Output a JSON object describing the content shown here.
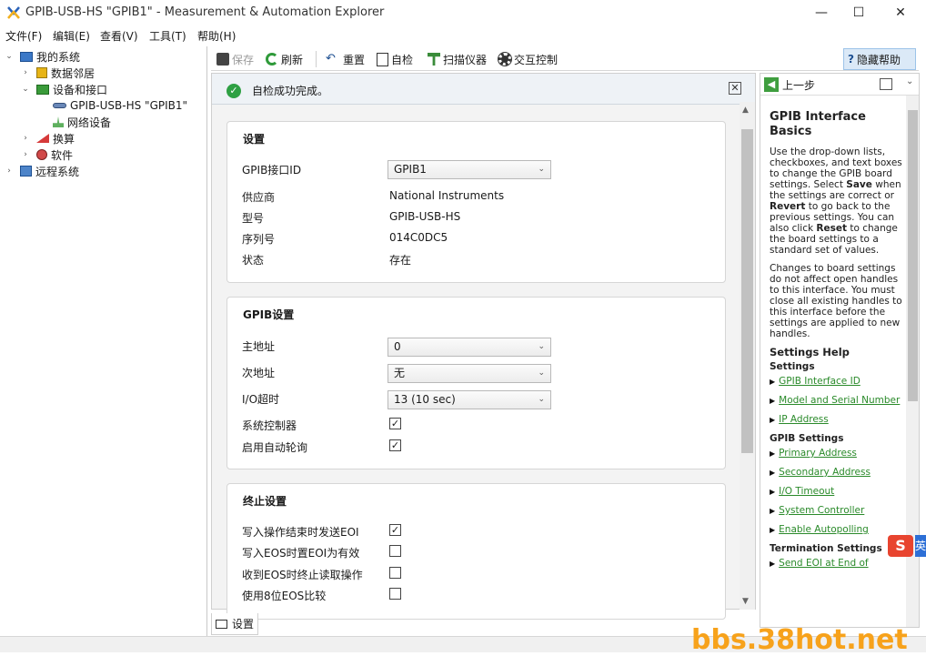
{
  "window": {
    "title": "GPIB-USB-HS \"GPIB1\" - Measurement & Automation Explorer",
    "minimize": "—",
    "maximize": "☐",
    "close": "✕"
  },
  "menu": [
    "文件(F)",
    "编辑(E)",
    "查看(V)",
    "工具(T)",
    "帮助(H)"
  ],
  "tree": [
    {
      "label": "我的系统",
      "expanded": true
    },
    {
      "label": "数据邻居",
      "expanded": false
    },
    {
      "label": "设备和接口",
      "expanded": true
    },
    {
      "label": "GPIB-USB-HS \"GPIB1\""
    },
    {
      "label": "网络设备"
    },
    {
      "label": "换算",
      "expanded": false
    },
    {
      "label": "软件",
      "expanded": false
    },
    {
      "label": "远程系统",
      "expanded": false
    }
  ],
  "toolbar": {
    "save": "保存",
    "refresh": "刷新",
    "reset": "重置",
    "selftest": "自检",
    "scan": "扫描仪器",
    "interactive": "交互控制",
    "hide_help": "隐藏帮助"
  },
  "status": {
    "message": "自检成功完成。",
    "close": "✕"
  },
  "settings_card": {
    "title": "设置",
    "rows": [
      {
        "label": "GPIB接口ID",
        "value": "GPIB1",
        "type": "select"
      },
      {
        "label": "供应商",
        "value": "National Instruments"
      },
      {
        "label": "型号",
        "value": "GPIB-USB-HS"
      },
      {
        "label": "序列号",
        "value": "014C0DC5"
      },
      {
        "label": "状态",
        "value": "存在"
      }
    ]
  },
  "gpib_card": {
    "title": "GPIB设置",
    "primary_label": "主地址",
    "primary_value": "0",
    "secondary_label": "次地址",
    "secondary_value": "无",
    "timeout_label": "I/O超时",
    "timeout_value": "13 (10 sec)",
    "controller_label": "系统控制器",
    "controller_checked": true,
    "autopoll_label": "启用自动轮询",
    "autopoll_checked": true
  },
  "term_card": {
    "title": "终止设置",
    "rows": [
      {
        "label": "写入操作结束时发送EOI",
        "checked": true
      },
      {
        "label": "写入EOS时置EOI为有效",
        "checked": false
      },
      {
        "label": "收到EOS时终止读取操作",
        "checked": false
      },
      {
        "label": "使用8位EOS比较",
        "checked": false
      }
    ]
  },
  "bottom_tab": "设置",
  "help": {
    "back": "上一步",
    "heading": "GPIB Interface Basics",
    "p1_a": "Use the drop-down lists, checkboxes, and text boxes to change the GPIB board settings. Select ",
    "p1_save": "Save",
    "p1_b": " when the settings are correct or ",
    "p1_revert": "Revert",
    "p1_c": " to go back to the previous settings. You can also click ",
    "p1_reset": "Reset",
    "p1_d": " to change the board settings to a standard set of values.",
    "p2": "Changes to board settings do not affect open handles to this interface. You must close all existing handles to this interface before the settings are applied to new handles.",
    "settings_help": "Settings Help",
    "settings": "Settings",
    "links_settings": [
      "GPIB Interface ID",
      "Model and Serial Number",
      "IP Address"
    ],
    "gpib_settings": "GPIB Settings",
    "links_gpib": [
      "Primary Address",
      "Secondary Address",
      "I/O Timeout",
      "System Controller",
      "Enable Autopolling"
    ],
    "termination_settings": "Termination Settings",
    "links_term": [
      "Send EOI at End of"
    ]
  },
  "watermark": "bbs.38hot.net",
  "ime_icon": "S",
  "ime_icon2": "英"
}
